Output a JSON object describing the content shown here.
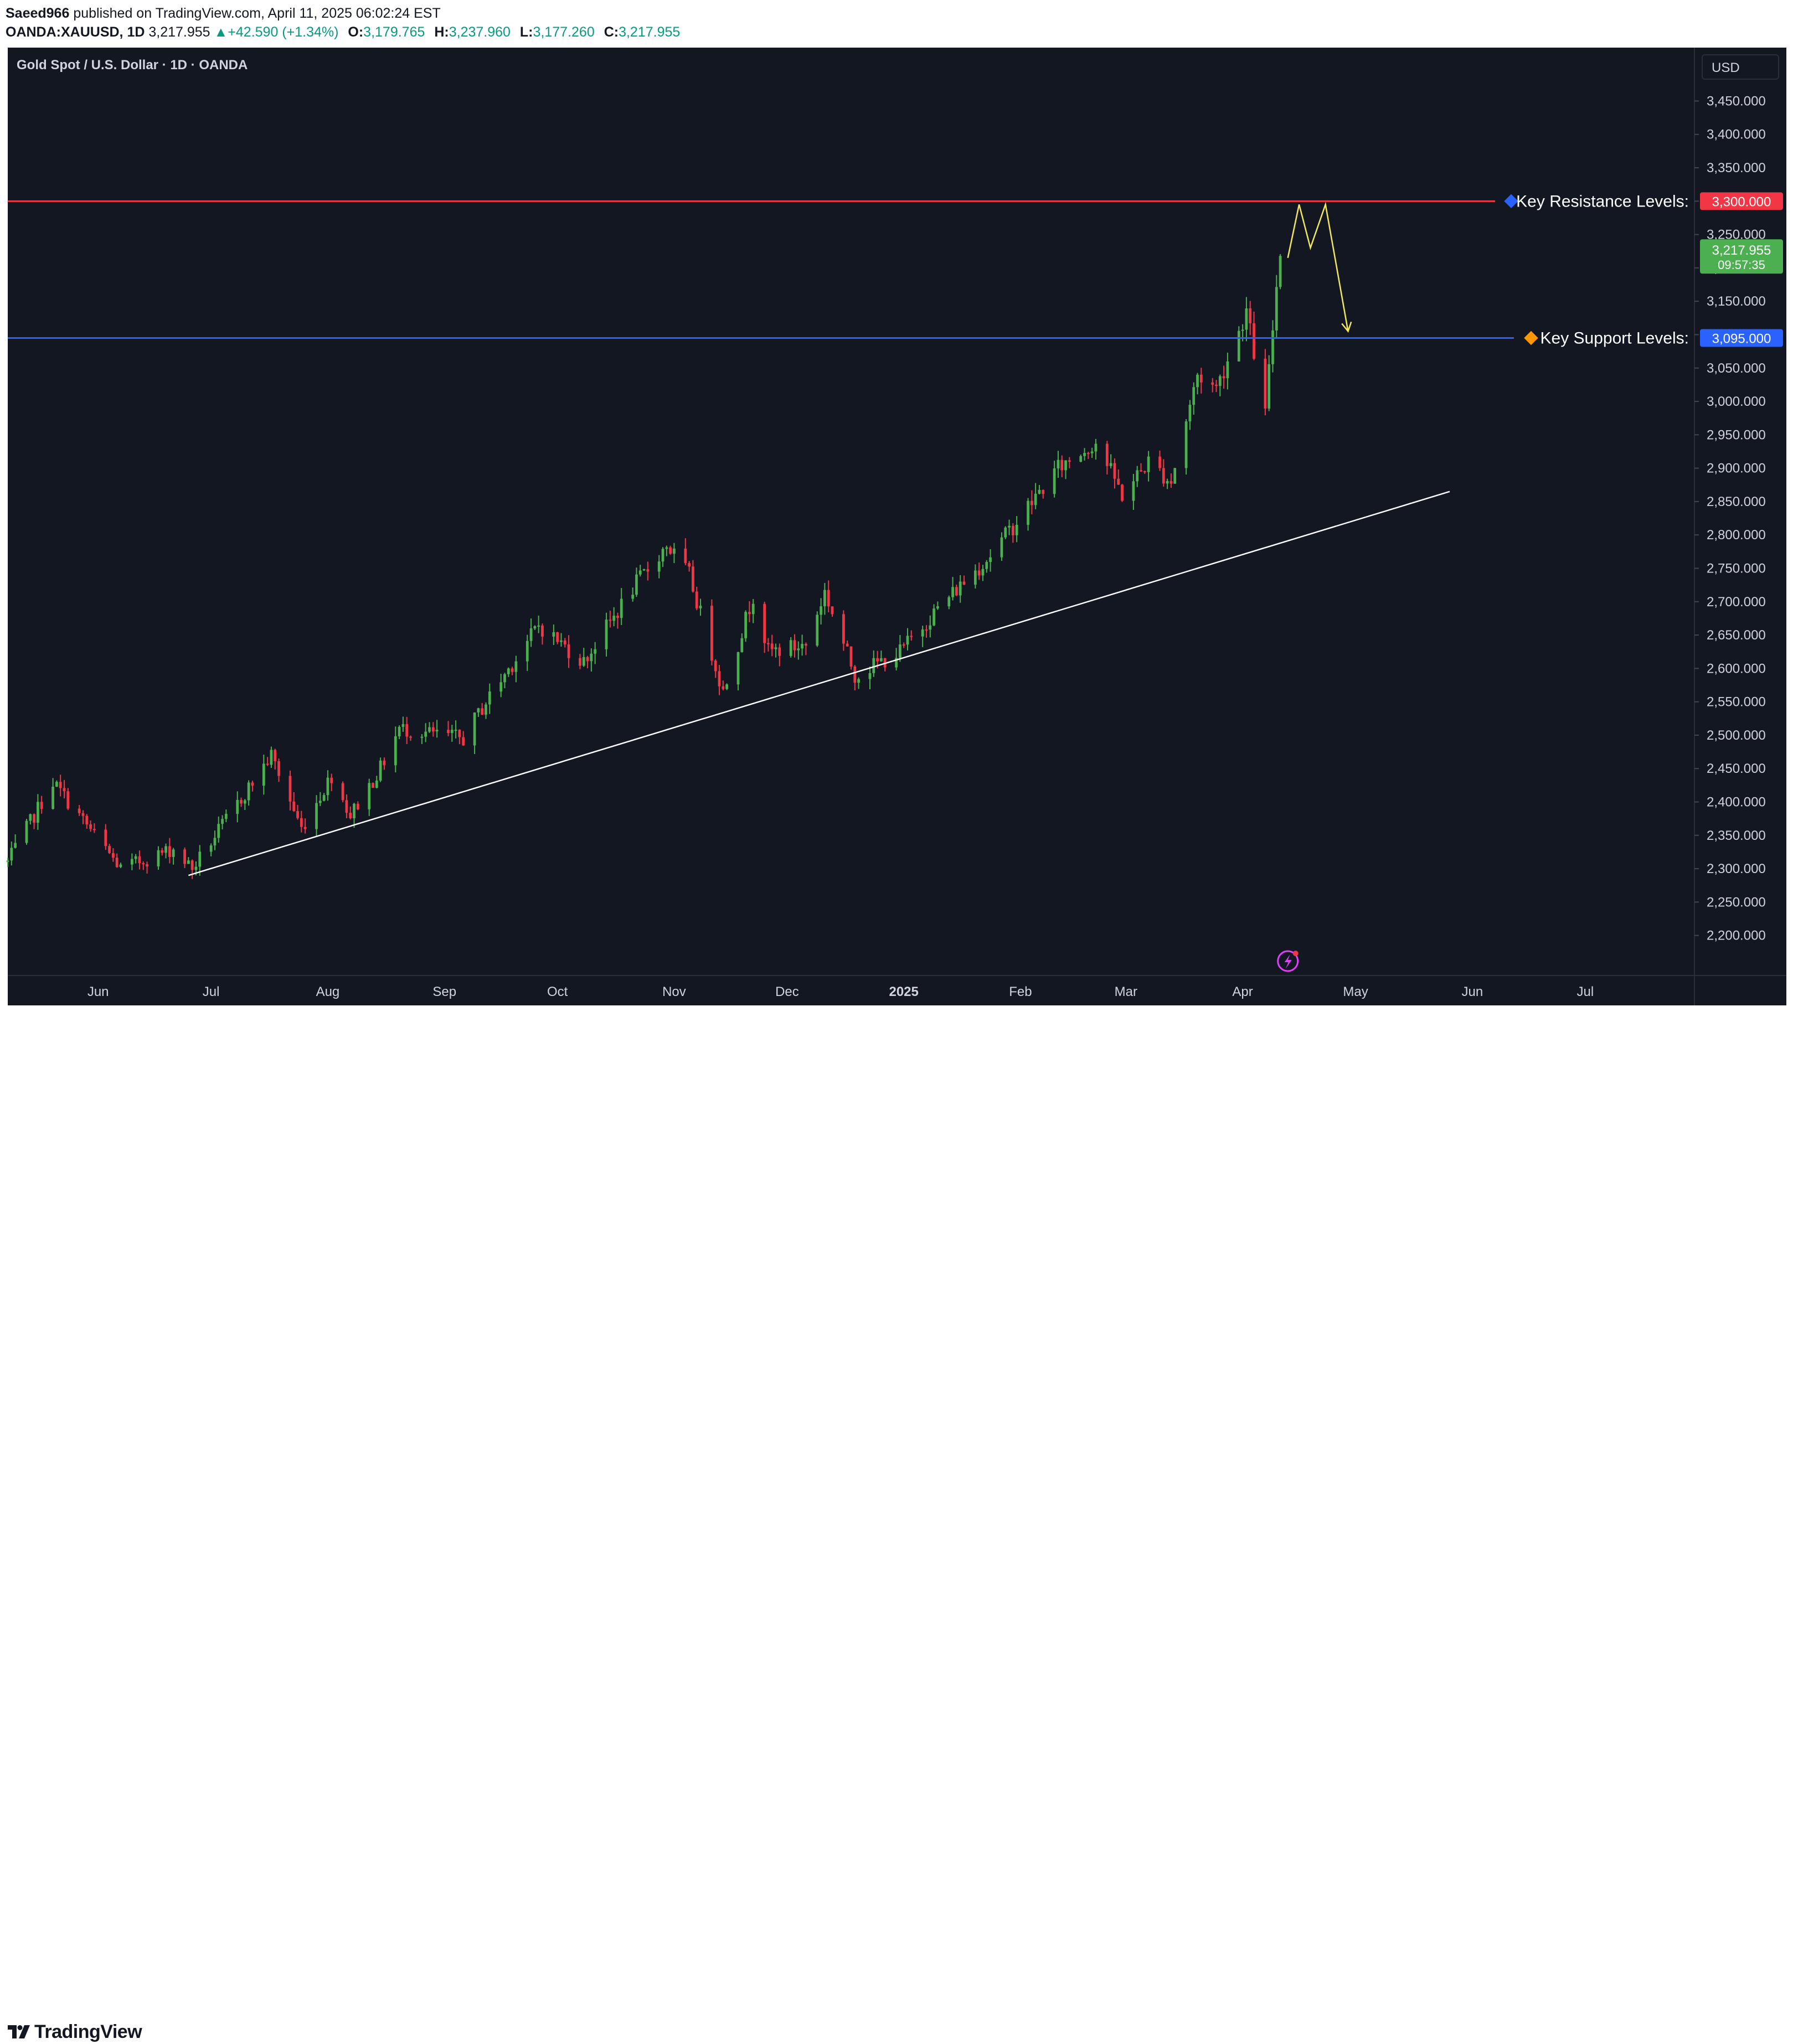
{
  "header": {
    "author": "Saeed966",
    "published_text": "published on TradingView.com, April 11, 2025 06:02:24 EST",
    "symbol": "OANDA:XAUUSD, 1D",
    "last": "3,217.955",
    "change_arrow": "▲",
    "change": "+42.590 (+1.34%)",
    "open_label": "O:",
    "open": "3,179.765",
    "high_label": "H:",
    "high": "3,237.960",
    "low_label": "L:",
    "low": "3,177.260",
    "close_label": "C:",
    "close": "3,217.955"
  },
  "chart_title": "Gold Spot / U.S. Dollar · 1D · OANDA",
  "currency": "USD",
  "footer": {
    "brand": "TradingView"
  },
  "colors": {
    "background": "#131722",
    "up": "#089981",
    "candle_up": "#4caf50",
    "candle_down": "#f23645",
    "resistance": "#f23645",
    "support": "#2962ff",
    "trendline": "#ffffff",
    "projection": "#f3e85a",
    "axis_text": "#d1d4dc"
  },
  "chart_data": {
    "type": "candlestick",
    "title": "Gold Spot / U.S. Dollar · 1D · OANDA",
    "ylim": [
      2140,
      3530
    ],
    "y_ticks": [
      2200,
      2250,
      2300,
      2350,
      2400,
      2450,
      2500,
      2550,
      2600,
      2650,
      2700,
      2750,
      2800,
      2850,
      2900,
      2950,
      3000,
      3050,
      3100,
      3150,
      3200,
      3250,
      3300,
      3350,
      3400,
      3450
    ],
    "x_range": [
      "2024-05-08",
      "2025-07-30"
    ],
    "x_ticks": [
      {
        "date": "2024-06-01",
        "label": "Jun",
        "bold": false
      },
      {
        "date": "2024-07-01",
        "label": "Jul",
        "bold": false
      },
      {
        "date": "2024-08-01",
        "label": "Aug",
        "bold": false
      },
      {
        "date": "2024-09-01",
        "label": "Sep",
        "bold": false
      },
      {
        "date": "2024-10-01",
        "label": "Oct",
        "bold": false
      },
      {
        "date": "2024-11-01",
        "label": "Nov",
        "bold": false
      },
      {
        "date": "2024-12-01",
        "label": "Dec",
        "bold": false
      },
      {
        "date": "2025-01-01",
        "label": "2025",
        "bold": true
      },
      {
        "date": "2025-02-01",
        "label": "Feb",
        "bold": false
      },
      {
        "date": "2025-03-01",
        "label": "Mar",
        "bold": false
      },
      {
        "date": "2025-04-01",
        "label": "Apr",
        "bold": false
      },
      {
        "date": "2025-05-01",
        "label": "May",
        "bold": false
      },
      {
        "date": "2025-06-01",
        "label": "Jun",
        "bold": false
      },
      {
        "date": "2025-07-01",
        "label": "Jul",
        "bold": false
      }
    ],
    "price_path": [
      [
        "2024-05-08",
        2310
      ],
      [
        "2024-05-20",
        2430
      ],
      [
        "2024-06-07",
        2300
      ],
      [
        "2024-06-21",
        2330
      ],
      [
        "2024-06-26",
        2300
      ],
      [
        "2024-07-17",
        2470
      ],
      [
        "2024-07-25",
        2360
      ],
      [
        "2024-08-02",
        2440
      ],
      [
        "2024-08-07",
        2380
      ],
      [
        "2024-08-15",
        2450
      ],
      [
        "2024-08-20",
        2510
      ],
      [
        "2024-09-06",
        2495
      ],
      [
        "2024-09-12",
        2550
      ],
      [
        "2024-09-26",
        2665
      ],
      [
        "2024-10-08",
        2610
      ],
      [
        "2024-10-21",
        2720
      ],
      [
        "2024-10-30",
        2785
      ],
      [
        "2024-11-05",
        2740
      ],
      [
        "2024-11-14",
        2565
      ],
      [
        "2024-11-22",
        2710
      ],
      [
        "2024-11-26",
        2625
      ],
      [
        "2024-12-06",
        2635
      ],
      [
        "2024-12-11",
        2715
      ],
      [
        "2024-12-19",
        2590
      ],
      [
        "2024-12-31",
        2625
      ],
      [
        "2025-01-10",
        2690
      ],
      [
        "2025-01-24",
        2770
      ],
      [
        "2025-02-11",
        2900
      ],
      [
        "2025-02-21",
        2940
      ],
      [
        "2025-02-28",
        2860
      ],
      [
        "2025-03-07",
        2910
      ],
      [
        "2025-03-13",
        2880
      ],
      [
        "2025-03-20",
        3040
      ],
      [
        "2025-03-25",
        3020
      ],
      [
        "2025-04-02",
        3135
      ],
      [
        "2025-04-07",
        2980
      ],
      [
        "2025-04-10",
        3175
      ],
      [
        "2025-04-11",
        3218
      ]
    ],
    "last": {
      "price": 3217.955,
      "label": "3,217.955",
      "countdown": "09:57:35"
    },
    "resistance": {
      "price": 3300,
      "label": "3,300.000",
      "text": "Key Resistance Levels:"
    },
    "support": {
      "price": 3095,
      "label": "3,095.000",
      "text": "Key Support Levels:"
    },
    "trendline": [
      [
        "2024-06-25",
        2290
      ],
      [
        "2025-05-26",
        2865
      ]
    ],
    "projection": [
      [
        "2025-04-13",
        3215
      ],
      [
        "2025-04-16",
        3295
      ],
      [
        "2025-04-19",
        3230
      ],
      [
        "2025-04-23",
        3295
      ],
      [
        "2025-04-29",
        3105
      ]
    ]
  }
}
